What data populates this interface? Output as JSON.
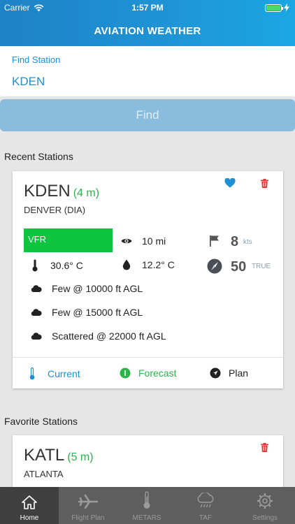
{
  "status_bar": {
    "carrier": "Carrier",
    "time": "1:57 PM"
  },
  "header": {
    "title": "AVIATION WEATHER"
  },
  "search": {
    "label": "Find Station",
    "value": "KDEN",
    "button_label": "Find"
  },
  "recent": {
    "title": "Recent Stations",
    "station": {
      "id": "KDEN",
      "age": "(4 m)",
      "city": "DENVER (DIA)",
      "flight_category": "VFR",
      "visibility": "10 mi",
      "temperature": "30.6° C",
      "dewpoint": "12.2° C",
      "wind_speed": "8",
      "wind_speed_unit": "kts",
      "wind_direction": "50",
      "wind_reference": "TRUE",
      "clouds": [
        "Few @ 10000 ft AGL",
        "Few @ 15000 ft AGL",
        "Scattered @ 22000 ft AGL"
      ],
      "actions": {
        "current": "Current",
        "forecast": "Forecast",
        "plan": "Plan"
      }
    }
  },
  "favorites": {
    "title": "Favorite Stations",
    "station": {
      "id": "KATL",
      "age": "(5 m)",
      "city": "ATLANTA"
    }
  },
  "tabs": [
    {
      "label": "Home",
      "icon": "home-icon"
    },
    {
      "label": "Flight Plan",
      "icon": "airplane-icon"
    },
    {
      "label": "METARS",
      "icon": "thermometer-icon"
    },
    {
      "label": "TAF",
      "icon": "rain-cloud-icon"
    },
    {
      "label": "Settings",
      "icon": "gear-icon"
    }
  ],
  "colors": {
    "accent_blue": "#1e8fd3",
    "vfr_green": "#0fc43e",
    "age_green": "#2cb34a",
    "delete_red": "#e53935",
    "tabbar_bg": "#5e5e5e"
  }
}
